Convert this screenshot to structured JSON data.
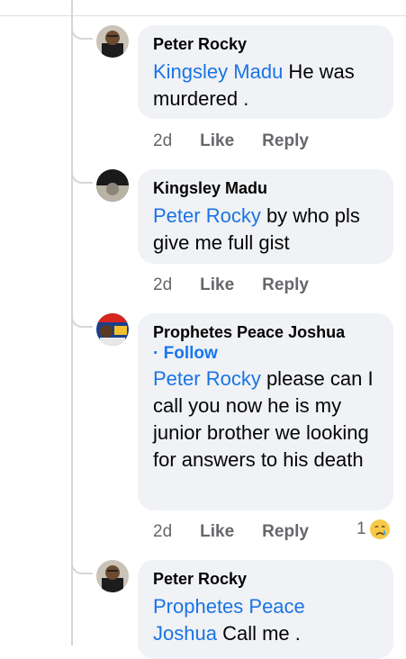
{
  "comments": [
    {
      "author": "Peter Rocky",
      "mention": "Kingsley Madu",
      "text": " He was murdered .",
      "time": "2d",
      "like": "Like",
      "reply": "Reply"
    },
    {
      "author": "Kingsley Madu",
      "mention": "Peter Rocky",
      "text": " by who pls give me full gist",
      "time": "2d",
      "like": "Like",
      "reply": "Reply"
    },
    {
      "author": "Prophetes Peace Joshua",
      "follow": "· Follow",
      "mention": "Peter Rocky",
      "text": " please can I call you now he is my junior brother we looking for answers to his death",
      "time": "2d",
      "like": "Like",
      "reply": "Reply",
      "reaction_count": "1",
      "reaction_icon": "crying-face-icon"
    },
    {
      "author": "Peter Rocky",
      "mention": "Prophetes Peace Joshua",
      "text": " Call me ."
    }
  ],
  "colors": {
    "bubble": "#f0f2f5",
    "mention": "#1b74e4",
    "meta": "#65676b"
  }
}
